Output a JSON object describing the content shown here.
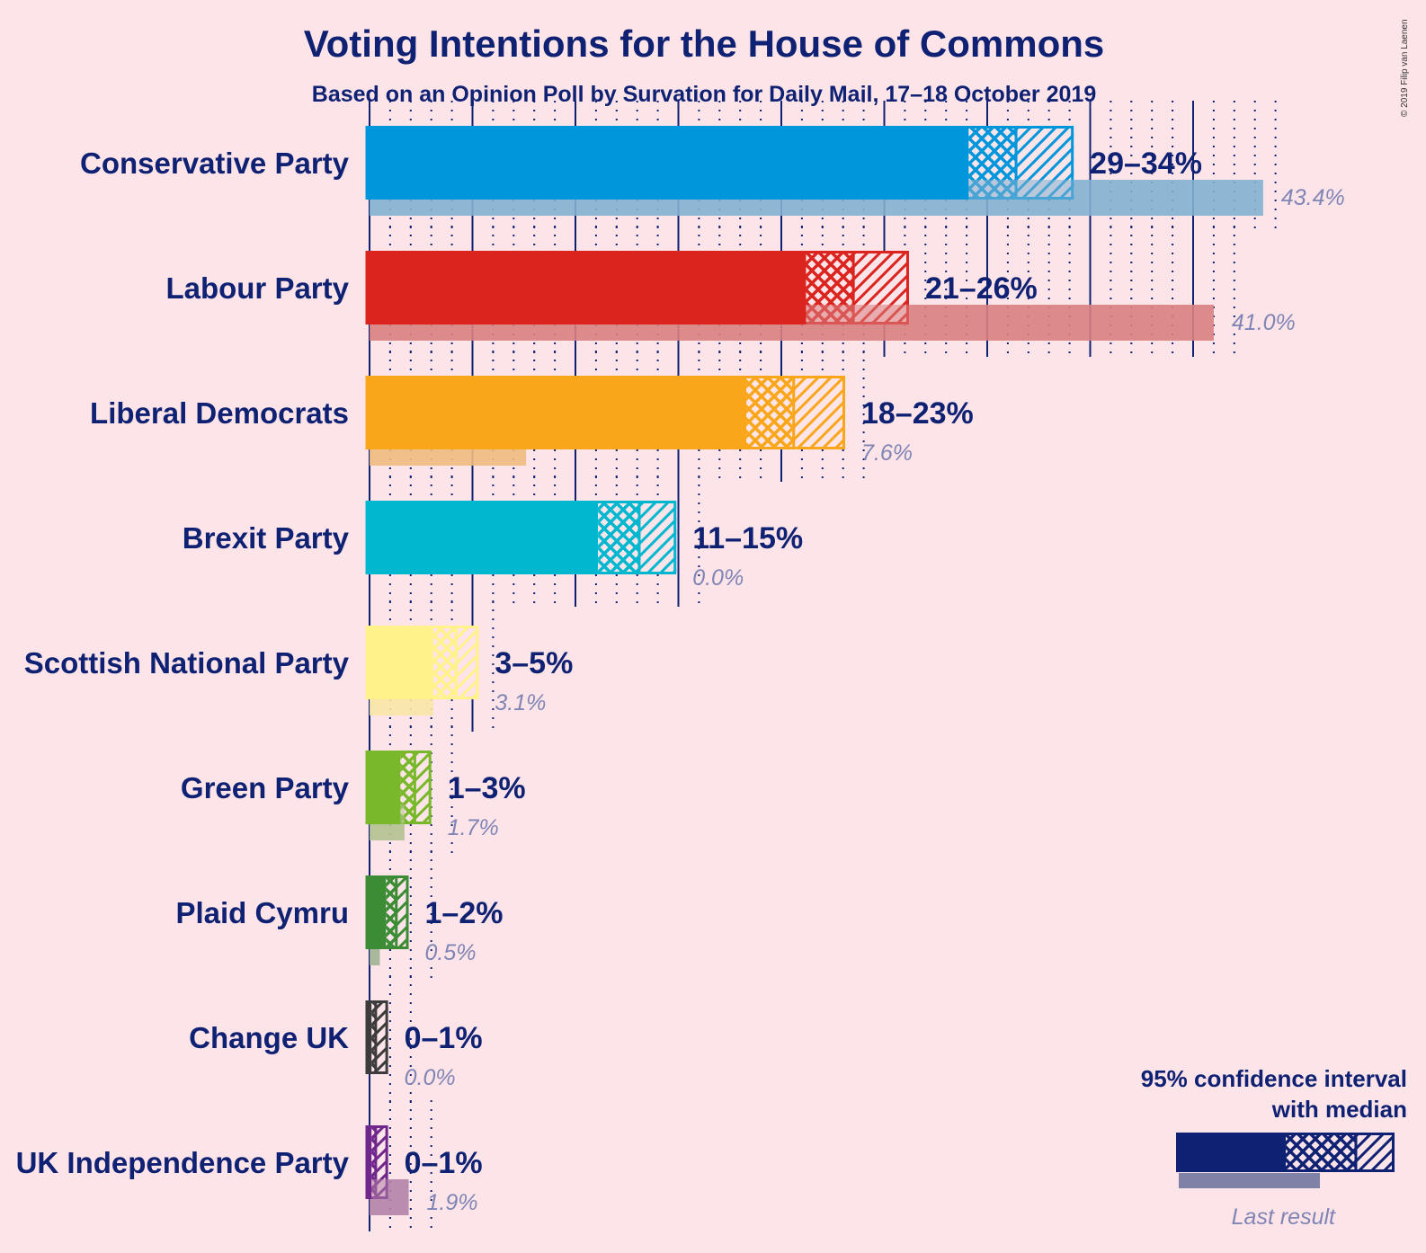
{
  "chart_data": {
    "type": "bar",
    "title": "Voting Intentions for the House of Commons",
    "subtitle": "Based on an Opinion Poll by Survation for Daily Mail, 17–18 October 2019",
    "copyright": "© 2019 Filip van Laenen",
    "xlabel": "",
    "ylabel": "",
    "xlim": [
      0,
      45
    ],
    "unit": "%",
    "gridlines": {
      "major_every": 5,
      "minor_every": 1
    },
    "legend": {
      "title_line1": "95% confidence interval",
      "title_line2": "with median",
      "last_result_label": "Last result",
      "placement": "bottom-right"
    },
    "categories": [
      "Conservative Party",
      "Labour Party",
      "Liberal Democrats",
      "Brexit Party",
      "Scottish National Party",
      "Green Party",
      "Plaid Cymru",
      "Change UK",
      "UK Independence Party"
    ],
    "series": [
      {
        "name": "Conservative Party",
        "ci_low": 29.1,
        "median": 31.4,
        "ci_high": 34.2,
        "range_label": "29–34%",
        "last_result": 43.4,
        "last_result_label": "43.4%",
        "color": "#0096db",
        "last_color": "#83b0cf"
      },
      {
        "name": "Labour Party",
        "ci_low": 21.2,
        "median": 23.5,
        "ci_high": 26.2,
        "range_label": "21–26%",
        "last_result": 41.0,
        "last_result_label": "41.0%",
        "color": "#dc241f",
        "last_color": "#d9807f"
      },
      {
        "name": "Liberal Democrats",
        "ci_low": 18.3,
        "median": 20.6,
        "ci_high": 23.1,
        "range_label": "18–23%",
        "last_result": 7.6,
        "last_result_label": "7.6%",
        "color": "#faa61a",
        "last_color": "#efbb7f"
      },
      {
        "name": "Brexit Party",
        "ci_low": 11.1,
        "median": 13.1,
        "ci_high": 14.9,
        "range_label": "11–15%",
        "last_result": 0.0,
        "last_result_label": "0.0%",
        "color": "#00b7d0",
        "last_color": "#7fc8d8"
      },
      {
        "name": "Scottish National Party",
        "ci_low": 3.1,
        "median": 4.2,
        "ci_high": 5.3,
        "range_label": "3–5%",
        "last_result": 3.1,
        "last_result_label": "3.1%",
        "color": "#fff28b",
        "last_color": "#f8e6a6"
      },
      {
        "name": "Green Party",
        "ci_low": 1.5,
        "median": 2.2,
        "ci_high": 3.0,
        "range_label": "1–3%",
        "last_result": 1.7,
        "last_result_label": "1.7%",
        "color": "#78b82a",
        "last_color": "#b3c191"
      },
      {
        "name": "Plaid Cymru",
        "ci_low": 0.8,
        "median": 1.3,
        "ci_high": 1.9,
        "range_label": "1–2%",
        "last_result": 0.5,
        "last_result_label": "0.5%",
        "color": "#3b8c35",
        "last_color": "#a0b194"
      },
      {
        "name": "Change UK",
        "ci_low": 0.1,
        "median": 0.3,
        "ci_high": 0.9,
        "range_label": "0–1%",
        "last_result": 0.0,
        "last_result_label": "0.0%",
        "color": "#3c3c3c",
        "last_color": "#a0a0a0"
      },
      {
        "name": "UK Independence Party",
        "ci_low": 0.1,
        "median": 0.3,
        "ci_high": 0.9,
        "range_label": "0–1%",
        "last_result": 1.9,
        "last_result_label": "1.9%",
        "color": "#70278c",
        "last_color": "#b282a8"
      }
    ]
  },
  "colors": {
    "background": "#fde4e8",
    "text": "#0f2173",
    "last_text": "#7f85b5",
    "grid": "#0f2173",
    "legend_bar": "#0f2173",
    "legend_last": "#8081a6"
  }
}
